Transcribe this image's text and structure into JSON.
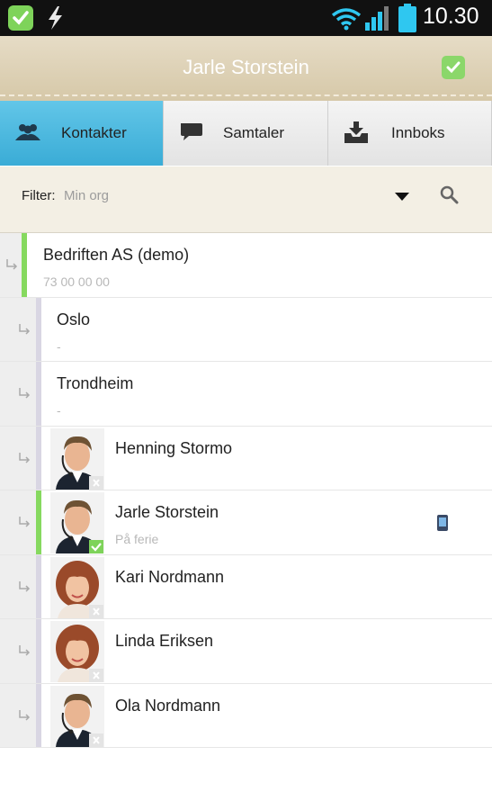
{
  "status_bar": {
    "time": "10.30"
  },
  "header": {
    "title": "Jarle Storstein"
  },
  "tabs": [
    {
      "label": "Kontakter",
      "icon": "contacts-icon",
      "active": true
    },
    {
      "label": "Samtaler",
      "icon": "chat-bubble-icon",
      "active": false
    },
    {
      "label": "Innboks",
      "icon": "inbox-icon",
      "active": false
    }
  ],
  "filter": {
    "label": "Filter:",
    "value": "Min org"
  },
  "list": [
    {
      "title": "Bedriften AS (demo)",
      "subtitle": "73 00 00 00"
    },
    {
      "title": "Oslo",
      "subtitle": "-"
    },
    {
      "title": "Trondheim",
      "subtitle": "-"
    },
    {
      "title": "Henning Stormo",
      "subtitle": ""
    },
    {
      "title": "Jarle Storstein",
      "subtitle": "På ferie"
    },
    {
      "title": "Kari Nordmann",
      "subtitle": ""
    },
    {
      "title": "Linda Eriksen",
      "subtitle": ""
    },
    {
      "title": "Ola Nordmann",
      "subtitle": ""
    }
  ],
  "colors": {
    "accent_blue": "#3aacd6",
    "available_green": "#86d95f",
    "header_beige": "#d6c8a8"
  }
}
